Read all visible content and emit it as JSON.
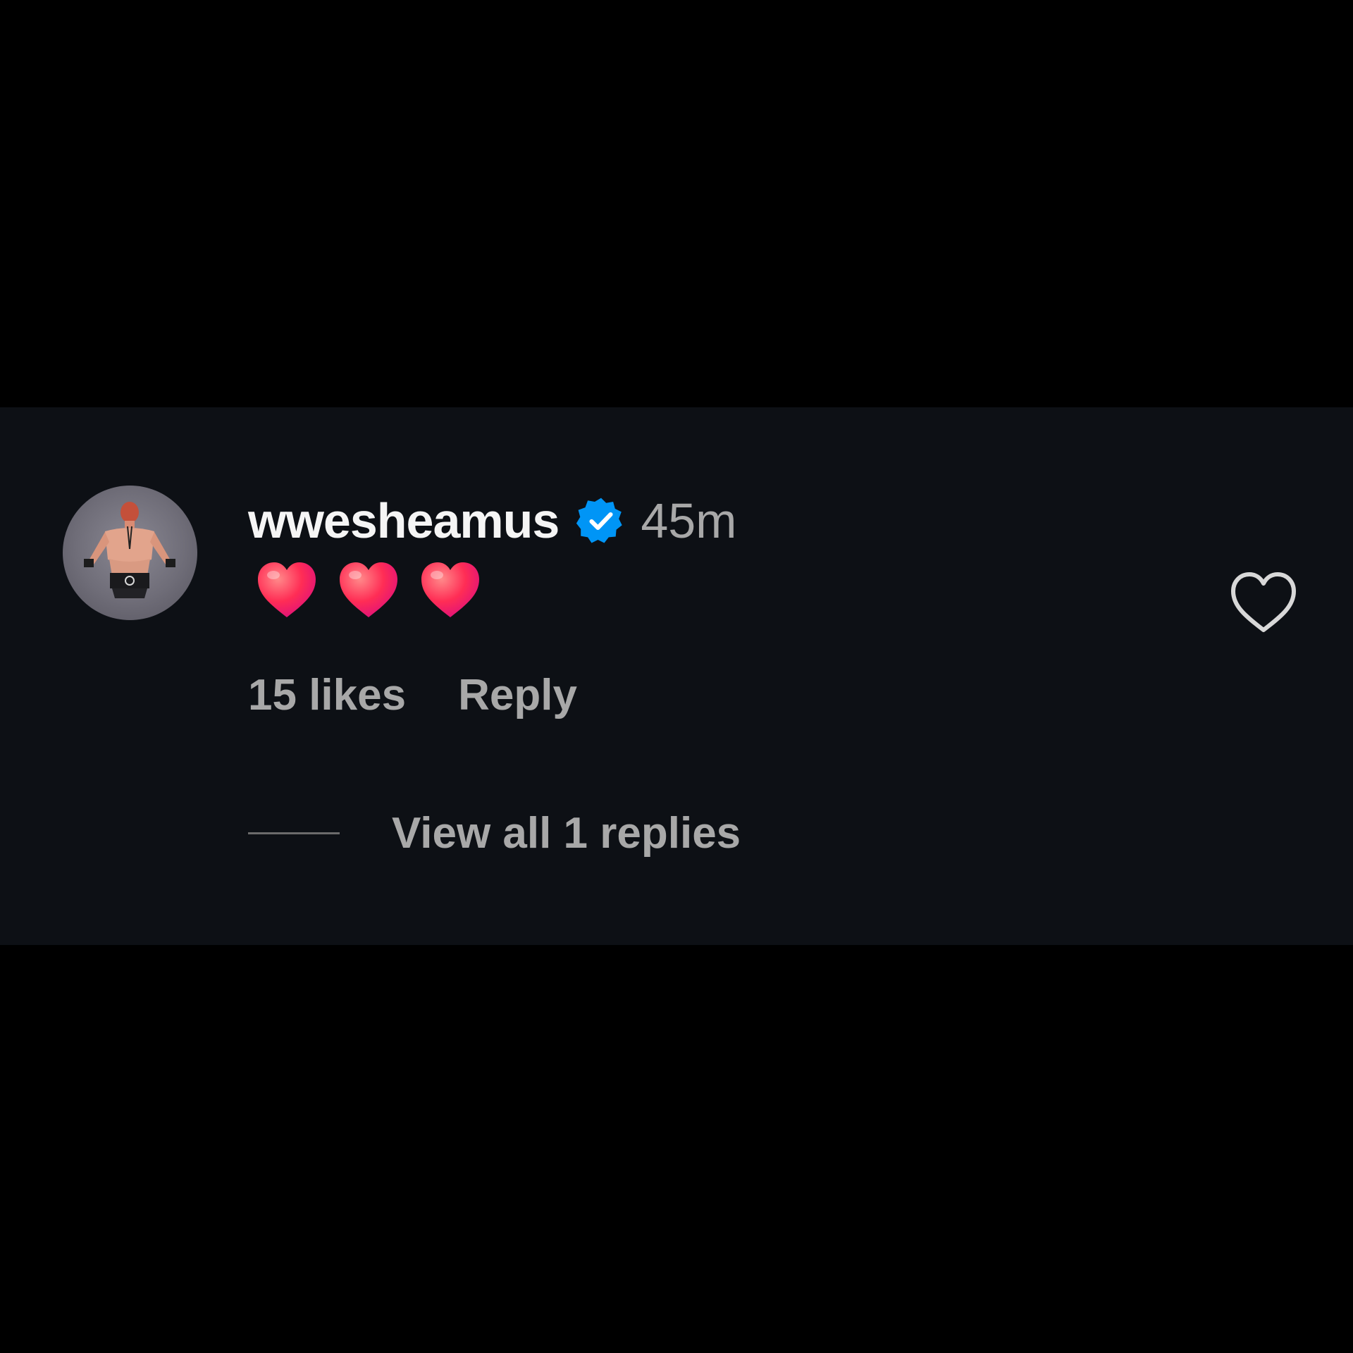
{
  "comment": {
    "username": "wwesheamus",
    "verified": true,
    "timestamp": "45m",
    "emojis": [
      "heart-emoji",
      "heart-emoji",
      "heart-emoji"
    ],
    "likes_label": "15 likes",
    "reply_label": "Reply",
    "view_replies_label": "View all 1 replies"
  },
  "colors": {
    "background": "#000000",
    "panel": "#0d1015",
    "username": "#f5f5f5",
    "muted_text": "#a8a8a8",
    "verified_badge": "#0095f6",
    "heart_emoji": "#ff2d6f"
  },
  "icons": {
    "verified": "verified-badge-icon",
    "like": "heart-outline-icon"
  }
}
